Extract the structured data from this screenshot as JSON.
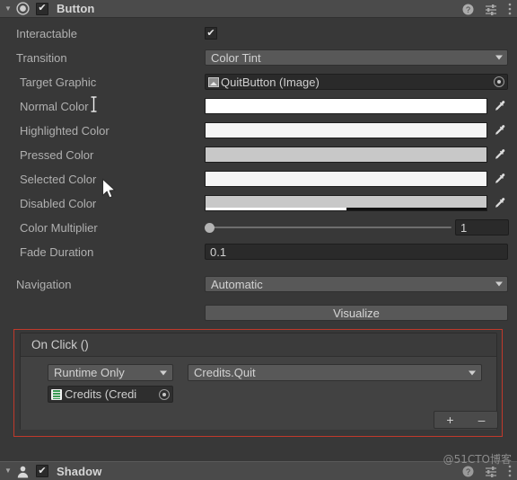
{
  "component": {
    "title": "Button",
    "enabled_check": "✔",
    "foldout": "▼",
    "help_icon": "help-icon",
    "preset_icon": "preset-icon",
    "menu_icon": "more-menu-icon"
  },
  "properties": {
    "interactable": {
      "label": "Interactable",
      "value": "✔"
    },
    "transition": {
      "label": "Transition",
      "value": "Color Tint"
    },
    "target_graphic": {
      "label": "Target Graphic",
      "value": "QuitButton (Image)"
    },
    "normal_color": {
      "label": "Normal Color",
      "color": "#ffffff",
      "alpha": 100
    },
    "highlighted_color": {
      "label": "Highlighted Color",
      "color": "#f5f5f5",
      "alpha": 100
    },
    "pressed_color": {
      "label": "Pressed Color",
      "color": "#c8c8c8",
      "alpha": 100
    },
    "selected_color": {
      "label": "Selected Color",
      "color": "#f5f5f5",
      "alpha": 100
    },
    "disabled_color": {
      "label": "Disabled Color",
      "color": "#c8c8c8",
      "alpha": 50
    },
    "color_multiplier": {
      "label": "Color Multiplier",
      "value": "1",
      "slider_pct": 0
    },
    "fade_duration": {
      "label": "Fade Duration",
      "value": "0.1"
    },
    "navigation": {
      "label": "Navigation",
      "value": "Automatic"
    },
    "visualize": {
      "label": "Visualize"
    }
  },
  "on_click": {
    "title": "On Click ()",
    "entry": {
      "call_state": "Runtime Only",
      "method": "Credits.Quit",
      "target_object": "Credits (Credi"
    },
    "add_label": "+",
    "remove_label": "–"
  },
  "next_component": {
    "title": "Shadow",
    "enabled_check": "✔",
    "foldout": "▼"
  },
  "watermark": "@51CTO博客",
  "colors": {
    "panel_bg": "#383838",
    "header_bg": "#4b4b4b",
    "field_bg": "#2a2a2a",
    "popup_bg": "#585858",
    "annotation_red": "#c0392b"
  }
}
